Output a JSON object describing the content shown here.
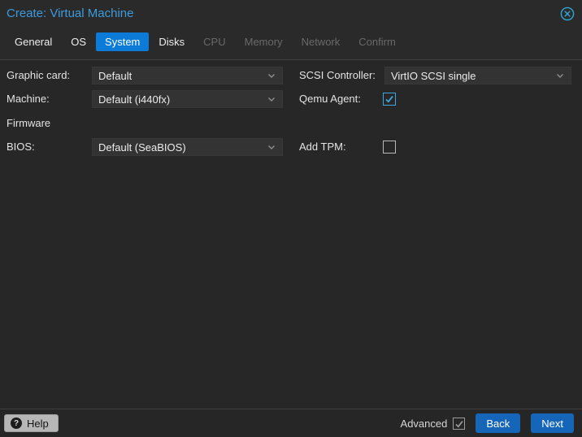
{
  "dialog": {
    "title": "Create: Virtual Machine"
  },
  "tabs": [
    {
      "label": "General",
      "state": "enabled"
    },
    {
      "label": "OS",
      "state": "enabled"
    },
    {
      "label": "System",
      "state": "active"
    },
    {
      "label": "Disks",
      "state": "enabled"
    },
    {
      "label": "CPU",
      "state": "disabled"
    },
    {
      "label": "Memory",
      "state": "disabled"
    },
    {
      "label": "Network",
      "state": "disabled"
    },
    {
      "label": "Confirm",
      "state": "disabled"
    }
  ],
  "form": {
    "graphic_card": {
      "label": "Graphic card:",
      "value": "Default"
    },
    "machine": {
      "label": "Machine:",
      "value": "Default (i440fx)"
    },
    "firmware_section": "Firmware",
    "bios": {
      "label": "BIOS:",
      "value": "Default (SeaBIOS)"
    },
    "scsi_controller": {
      "label": "SCSI Controller:",
      "value": "VirtIO SCSI single"
    },
    "qemu_agent": {
      "label": "Qemu Agent:",
      "checked": true
    },
    "add_tpm": {
      "label": "Add TPM:",
      "checked": false
    }
  },
  "footer": {
    "help_label": "Help",
    "help_icon_glyph": "?",
    "advanced_label": "Advanced",
    "advanced_checked": true,
    "back_label": "Back",
    "next_label": "Next"
  },
  "colors": {
    "active_tab_blue": "#0c7bd8",
    "button_blue": "#1565b8",
    "title_blue": "#3d9bdc",
    "checkbox_blue": "#3da9e4",
    "background": "#272727"
  }
}
